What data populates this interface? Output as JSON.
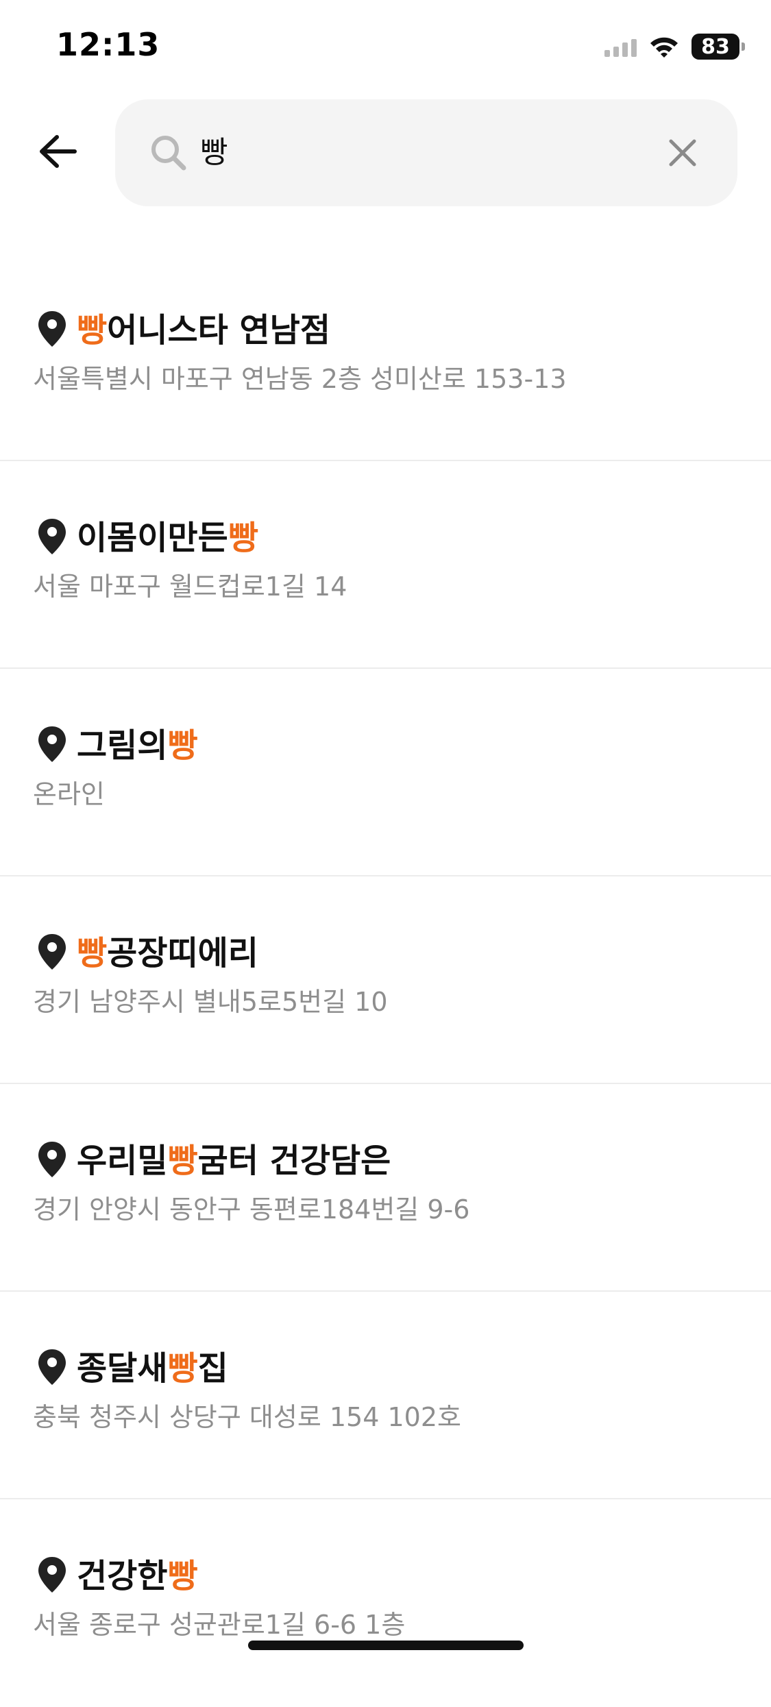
{
  "status_bar": {
    "time": "12:13",
    "battery": "83",
    "icons": [
      "cellular-signal-icon",
      "wifi-icon",
      "battery-icon"
    ]
  },
  "search": {
    "query": "빵",
    "back_icon": "arrow-left-icon",
    "search_icon": "magnifier-icon",
    "clear_icon": "close-icon"
  },
  "colors": {
    "highlight": "#ef6c1a",
    "address": "#8e8e8e",
    "search_bg": "#f4f4f4"
  },
  "results": [
    {
      "title_before": "",
      "title_match": "빵",
      "title_after": "어니스타 연남점",
      "address": "서울특별시 마포구 연남동 2층 성미산로 153-13"
    },
    {
      "title_before": "이몸이만든",
      "title_match": "빵",
      "title_after": "",
      "address": "서울 마포구 월드컵로1길 14"
    },
    {
      "title_before": "그림의",
      "title_match": "빵",
      "title_after": "",
      "address": "온라인"
    },
    {
      "title_before": "",
      "title_match": "빵",
      "title_after": "공장띠에리",
      "address": "경기 남양주시 별내5로5번길 10"
    },
    {
      "title_before": "우리밀",
      "title_match": "빵",
      "title_after": "굼터 건강담은",
      "address": "경기 안양시 동안구 동편로184번길 9-6"
    },
    {
      "title_before": "종달새",
      "title_match": "빵",
      "title_after": "집",
      "address": "충북 청주시 상당구 대성로 154 102호"
    },
    {
      "title_before": "건강한",
      "title_match": "빵",
      "title_after": "",
      "address": "서울 종로구 성균관로1길 6-6 1층"
    }
  ]
}
